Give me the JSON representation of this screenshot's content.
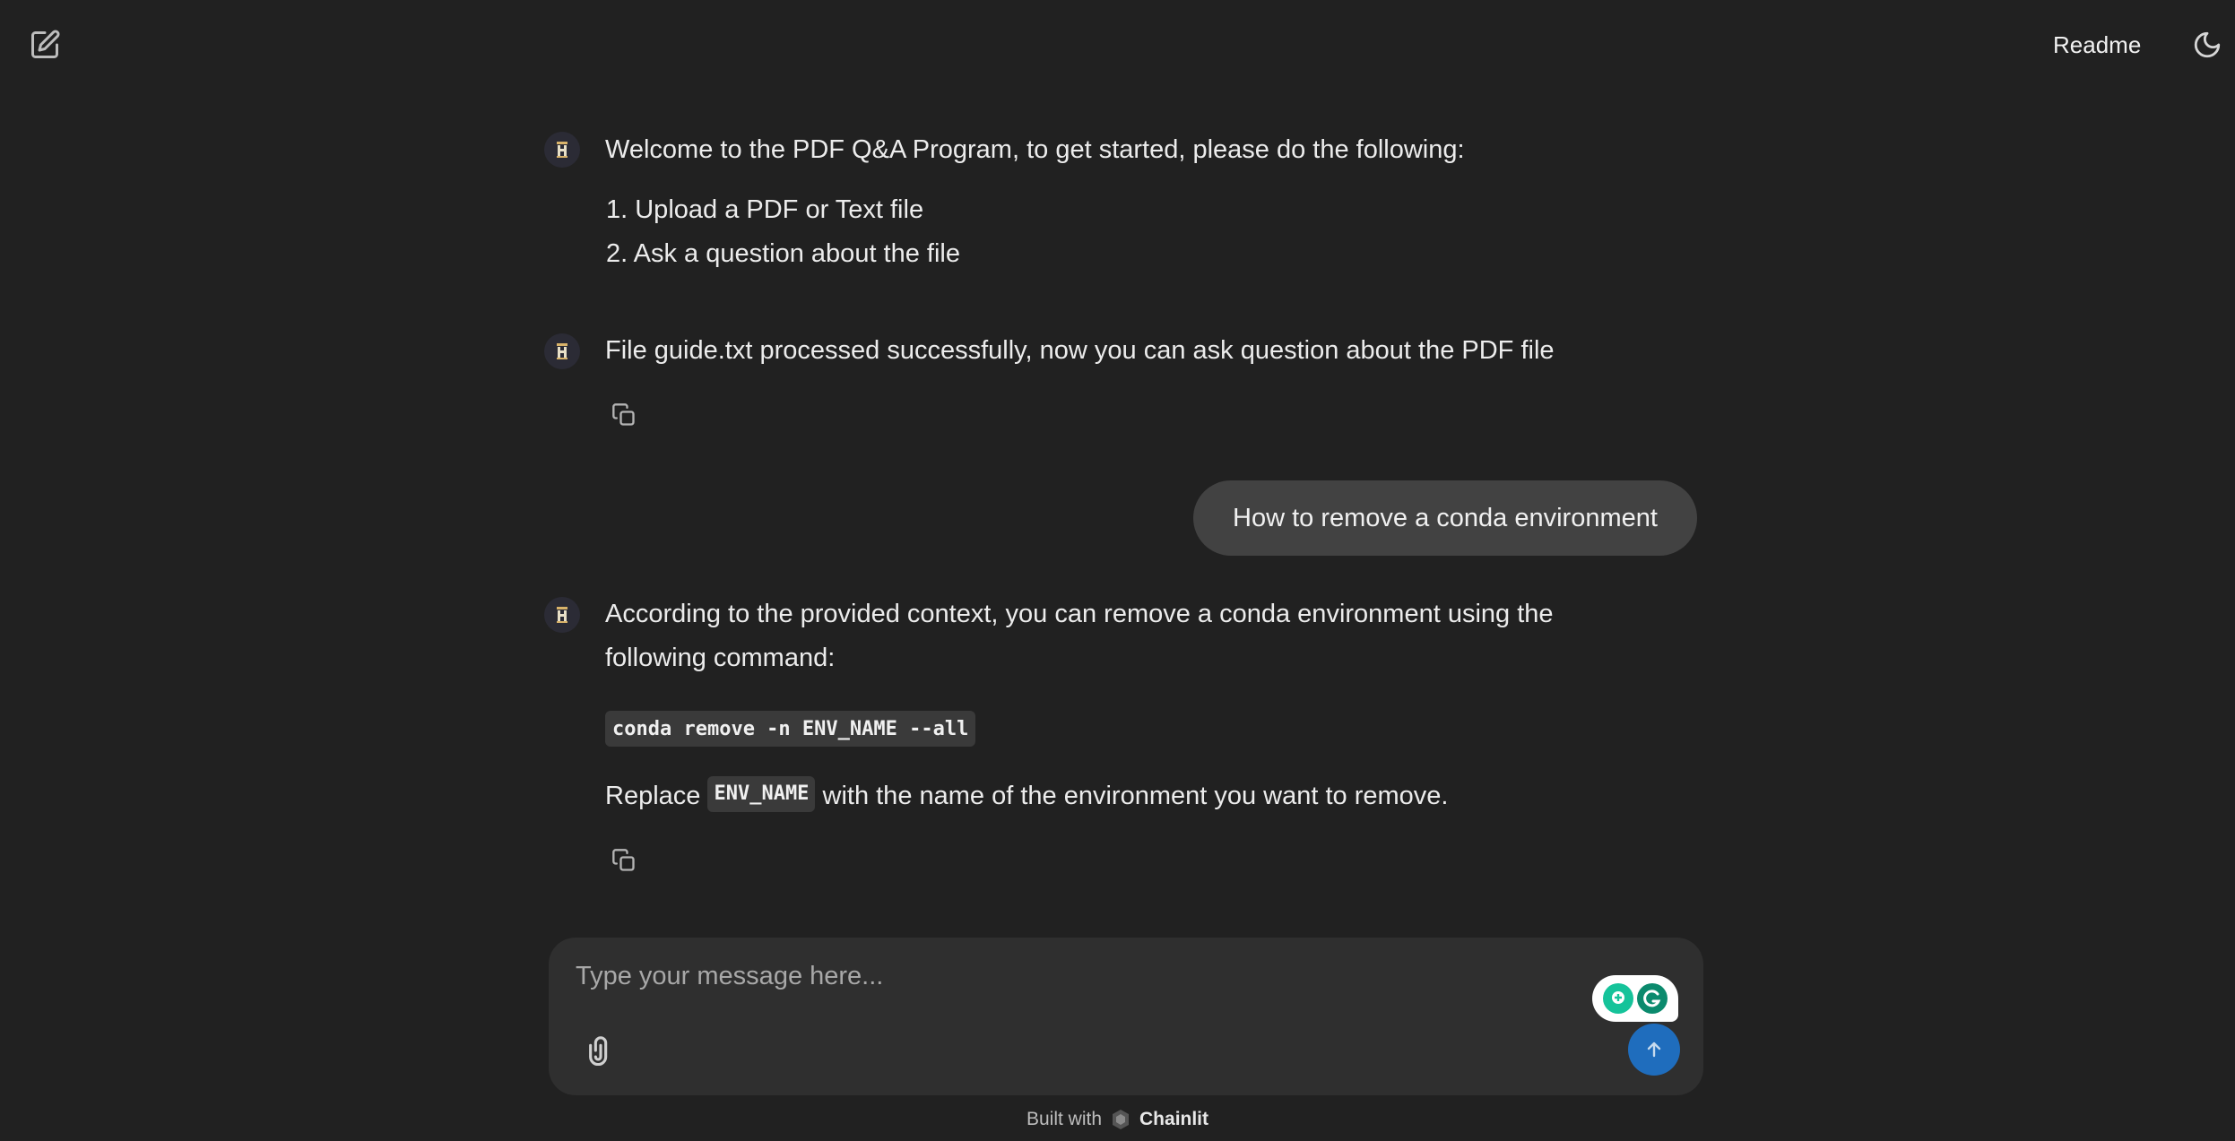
{
  "header": {
    "new_chat_icon": "edit-icon",
    "readme_label": "Readme",
    "theme_icon": "moon-icon"
  },
  "messages": [
    {
      "role": "assistant",
      "text": "Welcome to the PDF Q&A Program, to get started, please do the following:",
      "list": [
        "1. Upload a PDF or Text file",
        "2. Ask a question about the file"
      ]
    },
    {
      "role": "assistant",
      "text": "File guide.txt processed successfully, now you can ask question about the PDF file"
    },
    {
      "role": "user",
      "text": "How to remove a conda environment"
    },
    {
      "role": "assistant",
      "text_line1": "According to the provided context, you can remove a conda environment using the",
      "text_line2": "following command:",
      "code": "conda remove -n ENV_NAME --all",
      "replace_prefix": "Replace",
      "replace_code": "ENV_NAME",
      "replace_suffix": "with the name of the environment you want to remove."
    }
  ],
  "composer": {
    "placeholder": "Type your message here...",
    "attach_icon": "paperclip-icon",
    "send_icon": "arrow-up-icon",
    "send_color": "#1f6dbd"
  },
  "footer": {
    "built_with": "Built with",
    "brand": "Chainlit"
  },
  "colors": {
    "background": "#212121",
    "user_bubble": "#424242",
    "composer": "#2f2f2f",
    "grammarly": "#15c39a"
  }
}
